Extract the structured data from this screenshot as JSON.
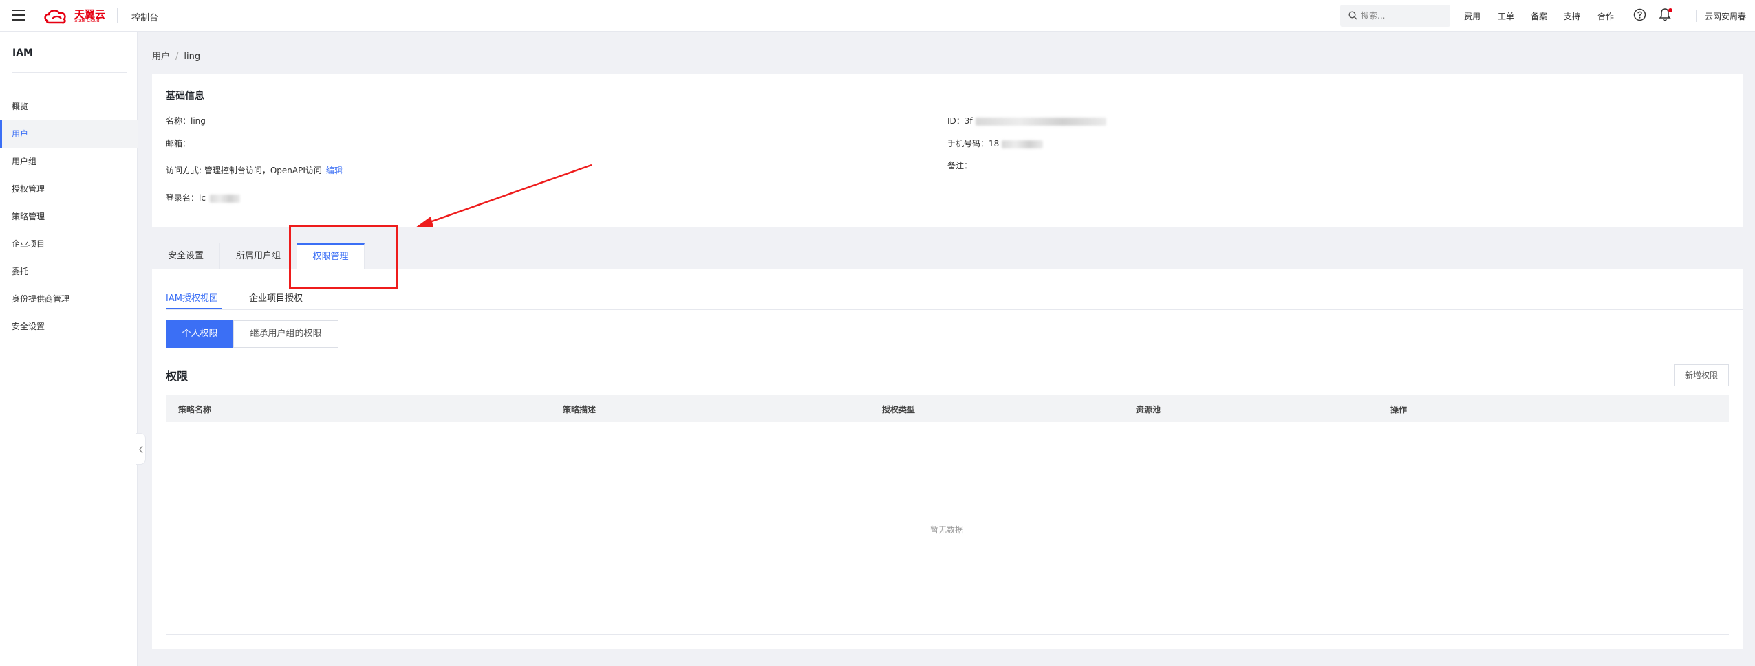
{
  "topbar": {
    "menu_icon": "hamburger-menu-icon",
    "logo_text": "天翼云",
    "logo_sub": "State Cloud",
    "console": "控制台",
    "search_placeholder": "搜索...",
    "nav": [
      "费用",
      "工单",
      "备案",
      "支持",
      "合作"
    ],
    "user": "云网安周春"
  },
  "sidebar": {
    "title": "IAM",
    "items": [
      {
        "label": "概览"
      },
      {
        "label": "用户",
        "active": true
      },
      {
        "label": "用户组"
      },
      {
        "label": "授权管理"
      },
      {
        "label": "策略管理"
      },
      {
        "label": "企业项目"
      },
      {
        "label": "委托"
      },
      {
        "label": "身份提供商管理"
      },
      {
        "label": "安全设置"
      }
    ]
  },
  "breadcrumb": {
    "parent": "用户",
    "sep": "/",
    "current": "ling"
  },
  "basic_info": {
    "title": "基础信息",
    "name": "名称：ling",
    "email": "邮箱：-",
    "access": "访问方式: 管理控制台访问，OpenAPI访问",
    "edit": "编辑",
    "login": "登录名：lc",
    "id": "ID：3f",
    "phone": "手机号码：18",
    "remark": "备注：-"
  },
  "tabs": [
    {
      "label": "安全设置"
    },
    {
      "label": "所属用户组"
    },
    {
      "label": "权限管理",
      "active": true
    }
  ],
  "permissions": {
    "subtabs": [
      "IAM授权视图",
      "企业项目授权"
    ],
    "buttons": [
      "个人权限",
      "继承用户组的权限"
    ],
    "title": "权限",
    "add": "新增权限",
    "columns": [
      "策略名称",
      "策略描述",
      "授权类型",
      "资源池",
      "操作"
    ],
    "empty": "暂无数据"
  },
  "colors": {
    "accent": "#3b6ff5",
    "brand": "#e60012",
    "annotation": "#ee1c1c"
  }
}
